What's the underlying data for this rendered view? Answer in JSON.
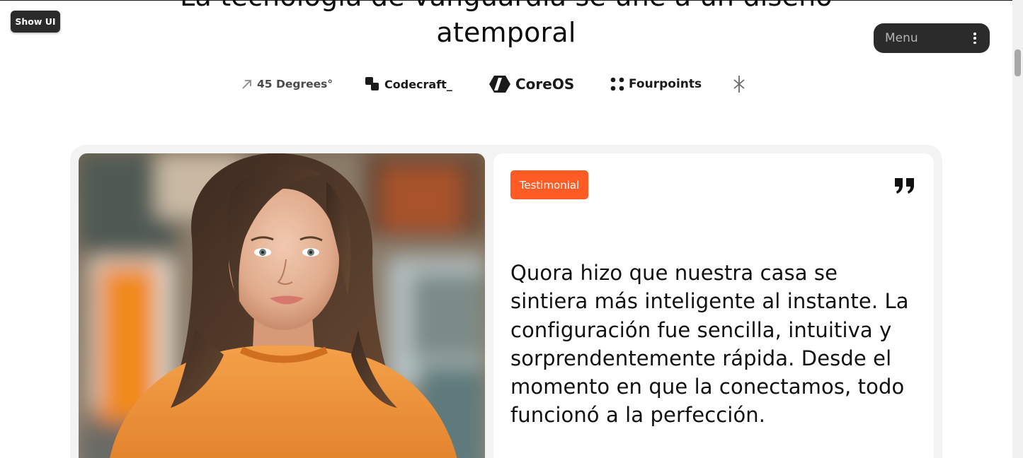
{
  "toolbar": {
    "show_ui_label": "Show UI"
  },
  "hero": {
    "heading": "La tecnología de vanguardia se une a un diseño atemporal"
  },
  "menu": {
    "label": "Menu",
    "icon": "kebab-icon"
  },
  "logos": [
    {
      "name": "45 Degrees°",
      "icon": "arrow-up-right-icon"
    },
    {
      "name": "Codecraft_",
      "icon": "codecraft-mark-icon"
    },
    {
      "name": "CoreOS",
      "icon": "coreos-mark-icon"
    },
    {
      "name": "Fourpoints",
      "icon": "four-dots-icon"
    },
    {
      "name": "",
      "icon": "asterisk-mark-icon"
    }
  ],
  "testimonial": {
    "badge": "Testimonial",
    "quote_icon": "quote-icon",
    "quote": "Quora hizo que nuestra casa se sintiera más inteligente al instante. La configuración fue sencilla, intuitiva y sorprendentemente rápida. Desde el momento en que la conectamos, todo funcionó a la perfección."
  },
  "colors": {
    "accent": "#ff5b24",
    "menu_bg": "#2b2b2b",
    "card_bg": "#f3f3f3"
  }
}
